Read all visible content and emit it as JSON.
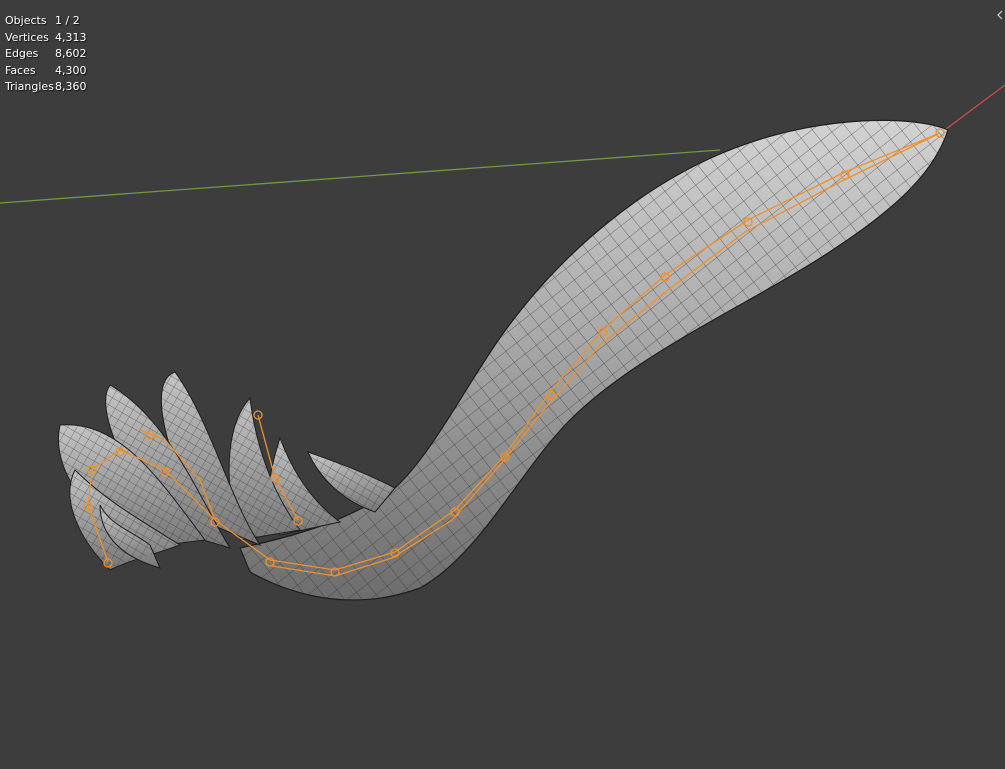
{
  "viewport": {
    "background": "#3d3d3d",
    "x_axis_color": "#c84d4d",
    "y_axis_color": "#6f9a43",
    "selection_color": "#f0902b",
    "mesh_color": "#9e9e9e",
    "wire_color": "#2b2b2b"
  },
  "stats": [
    {
      "label": "Objects",
      "value": "1 / 2"
    },
    {
      "label": "Vertices",
      "value": "4,313"
    },
    {
      "label": "Edges",
      "value": "8,602"
    },
    {
      "label": "Faces",
      "value": "4,300"
    },
    {
      "label": "Triangles",
      "value": "8,360"
    }
  ],
  "icons": {
    "corner_handle": "chevron-left-icon"
  }
}
